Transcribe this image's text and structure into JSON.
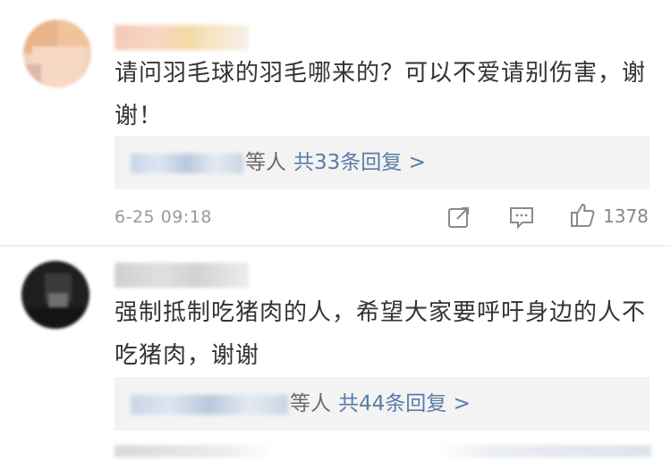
{
  "comments": [
    {
      "text": "请问羽毛球的羽毛哪来的？可以不爱请别伤害，谢谢！",
      "reply_suffix": "等人",
      "reply_summary": "共33条回复 >",
      "time": "6-25 09:18",
      "likes": "1378"
    },
    {
      "text": "强制抵制吃猪肉的人，希望大家要呼吁身边的人不吃猪肉，谢谢",
      "reply_suffix": "等人",
      "reply_summary": "共44条回复 >"
    }
  ],
  "icons": {
    "share": "share-icon",
    "comment": "comment-icon",
    "like": "thumbs-up-icon"
  },
  "colors": {
    "link_blue": "#5a7ca8",
    "reply_bg": "#f3f3f3",
    "meta_gray": "#999999"
  }
}
